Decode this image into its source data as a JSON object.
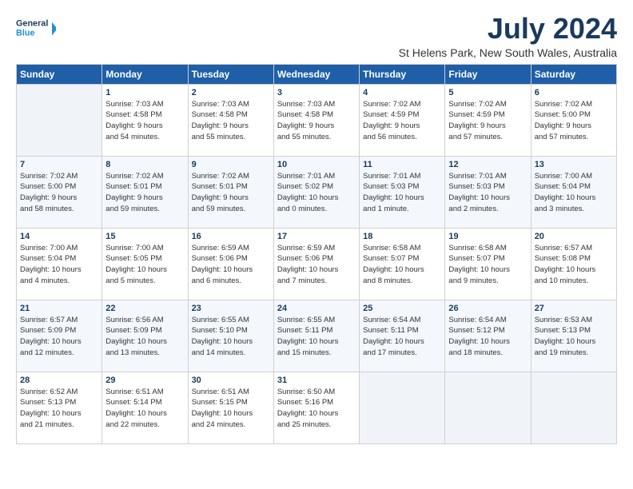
{
  "logo": {
    "line1": "General",
    "line2": "Blue"
  },
  "title": "July 2024",
  "subtitle": "St Helens Park, New South Wales, Australia",
  "headers": [
    "Sunday",
    "Monday",
    "Tuesday",
    "Wednesday",
    "Thursday",
    "Friday",
    "Saturday"
  ],
  "weeks": [
    [
      {
        "day": "",
        "info": ""
      },
      {
        "day": "1",
        "info": "Sunrise: 7:03 AM\nSunset: 4:58 PM\nDaylight: 9 hours\nand 54 minutes."
      },
      {
        "day": "2",
        "info": "Sunrise: 7:03 AM\nSunset: 4:58 PM\nDaylight: 9 hours\nand 55 minutes."
      },
      {
        "day": "3",
        "info": "Sunrise: 7:03 AM\nSunset: 4:58 PM\nDaylight: 9 hours\nand 55 minutes."
      },
      {
        "day": "4",
        "info": "Sunrise: 7:02 AM\nSunset: 4:59 PM\nDaylight: 9 hours\nand 56 minutes."
      },
      {
        "day": "5",
        "info": "Sunrise: 7:02 AM\nSunset: 4:59 PM\nDaylight: 9 hours\nand 57 minutes."
      },
      {
        "day": "6",
        "info": "Sunrise: 7:02 AM\nSunset: 5:00 PM\nDaylight: 9 hours\nand 57 minutes."
      }
    ],
    [
      {
        "day": "7",
        "info": "Sunrise: 7:02 AM\nSunset: 5:00 PM\nDaylight: 9 hours\nand 58 minutes."
      },
      {
        "day": "8",
        "info": "Sunrise: 7:02 AM\nSunset: 5:01 PM\nDaylight: 9 hours\nand 59 minutes."
      },
      {
        "day": "9",
        "info": "Sunrise: 7:02 AM\nSunset: 5:01 PM\nDaylight: 9 hours\nand 59 minutes."
      },
      {
        "day": "10",
        "info": "Sunrise: 7:01 AM\nSunset: 5:02 PM\nDaylight: 10 hours\nand 0 minutes."
      },
      {
        "day": "11",
        "info": "Sunrise: 7:01 AM\nSunset: 5:03 PM\nDaylight: 10 hours\nand 1 minute."
      },
      {
        "day": "12",
        "info": "Sunrise: 7:01 AM\nSunset: 5:03 PM\nDaylight: 10 hours\nand 2 minutes."
      },
      {
        "day": "13",
        "info": "Sunrise: 7:00 AM\nSunset: 5:04 PM\nDaylight: 10 hours\nand 3 minutes."
      }
    ],
    [
      {
        "day": "14",
        "info": "Sunrise: 7:00 AM\nSunset: 5:04 PM\nDaylight: 10 hours\nand 4 minutes."
      },
      {
        "day": "15",
        "info": "Sunrise: 7:00 AM\nSunset: 5:05 PM\nDaylight: 10 hours\nand 5 minutes."
      },
      {
        "day": "16",
        "info": "Sunrise: 6:59 AM\nSunset: 5:06 PM\nDaylight: 10 hours\nand 6 minutes."
      },
      {
        "day": "17",
        "info": "Sunrise: 6:59 AM\nSunset: 5:06 PM\nDaylight: 10 hours\nand 7 minutes."
      },
      {
        "day": "18",
        "info": "Sunrise: 6:58 AM\nSunset: 5:07 PM\nDaylight: 10 hours\nand 8 minutes."
      },
      {
        "day": "19",
        "info": "Sunrise: 6:58 AM\nSunset: 5:07 PM\nDaylight: 10 hours\nand 9 minutes."
      },
      {
        "day": "20",
        "info": "Sunrise: 6:57 AM\nSunset: 5:08 PM\nDaylight: 10 hours\nand 10 minutes."
      }
    ],
    [
      {
        "day": "21",
        "info": "Sunrise: 6:57 AM\nSunset: 5:09 PM\nDaylight: 10 hours\nand 12 minutes."
      },
      {
        "day": "22",
        "info": "Sunrise: 6:56 AM\nSunset: 5:09 PM\nDaylight: 10 hours\nand 13 minutes."
      },
      {
        "day": "23",
        "info": "Sunrise: 6:55 AM\nSunset: 5:10 PM\nDaylight: 10 hours\nand 14 minutes."
      },
      {
        "day": "24",
        "info": "Sunrise: 6:55 AM\nSunset: 5:11 PM\nDaylight: 10 hours\nand 15 minutes."
      },
      {
        "day": "25",
        "info": "Sunrise: 6:54 AM\nSunset: 5:11 PM\nDaylight: 10 hours\nand 17 minutes."
      },
      {
        "day": "26",
        "info": "Sunrise: 6:54 AM\nSunset: 5:12 PM\nDaylight: 10 hours\nand 18 minutes."
      },
      {
        "day": "27",
        "info": "Sunrise: 6:53 AM\nSunset: 5:13 PM\nDaylight: 10 hours\nand 19 minutes."
      }
    ],
    [
      {
        "day": "28",
        "info": "Sunrise: 6:52 AM\nSunset: 5:13 PM\nDaylight: 10 hours\nand 21 minutes."
      },
      {
        "day": "29",
        "info": "Sunrise: 6:51 AM\nSunset: 5:14 PM\nDaylight: 10 hours\nand 22 minutes."
      },
      {
        "day": "30",
        "info": "Sunrise: 6:51 AM\nSunset: 5:15 PM\nDaylight: 10 hours\nand 24 minutes."
      },
      {
        "day": "31",
        "info": "Sunrise: 6:50 AM\nSunset: 5:16 PM\nDaylight: 10 hours\nand 25 minutes."
      },
      {
        "day": "",
        "info": ""
      },
      {
        "day": "",
        "info": ""
      },
      {
        "day": "",
        "info": ""
      }
    ]
  ]
}
